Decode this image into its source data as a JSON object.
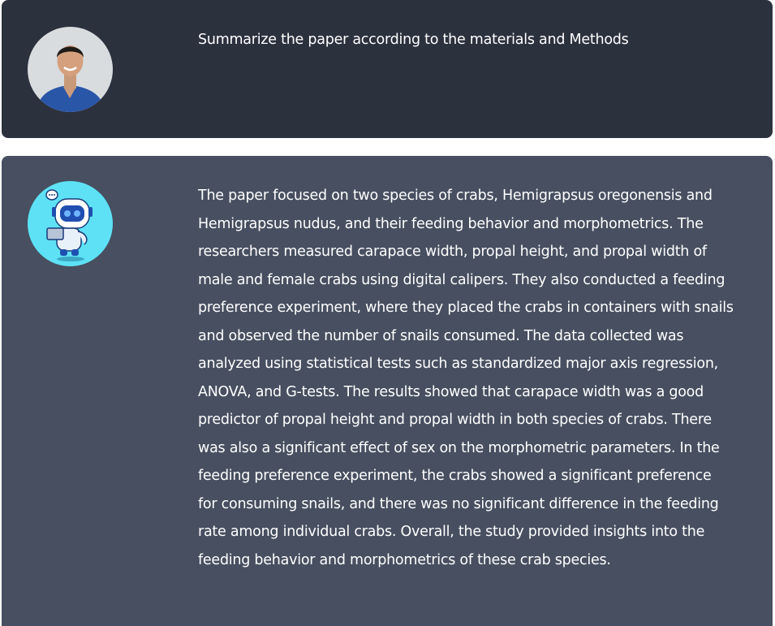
{
  "conversation": {
    "user_message": {
      "text": "Summarize the paper according to the materials and Methods"
    },
    "assistant_message": {
      "text": "The paper focused on two species of crabs, Hemigrapsus oregonensis and Hemigrapsus nudus, and their feeding behavior and morphometrics. The researchers measured carapace width, propal height, and propal width of male and female crabs using digital calipers. They also conducted a feeding preference experiment, where they placed the crabs in containers with snails and observed the number of snails consumed. The data collected was analyzed using statistical tests such as standardized major axis regression, ANOVA, and G-tests. The results showed that carapace width was a good predictor of propal height and propal width in both species of crabs. There was also a significant effect of sex on the morphometric parameters. In the feeding preference experiment, the crabs showed a significant preference for consuming snails, and there was no significant difference in the feeding rate among individual crabs. Overall, the study provided insights into the feeding behavior and morphometrics of these crab species."
    }
  },
  "colors": {
    "user_bg": "#2c313e",
    "assistant_bg": "#474f60",
    "text": "#ffffff",
    "bot_avatar_bg": "#5ee1f5"
  },
  "icons": {
    "user_avatar": "user-photo-avatar",
    "assistant_avatar": "robot-avatar"
  }
}
